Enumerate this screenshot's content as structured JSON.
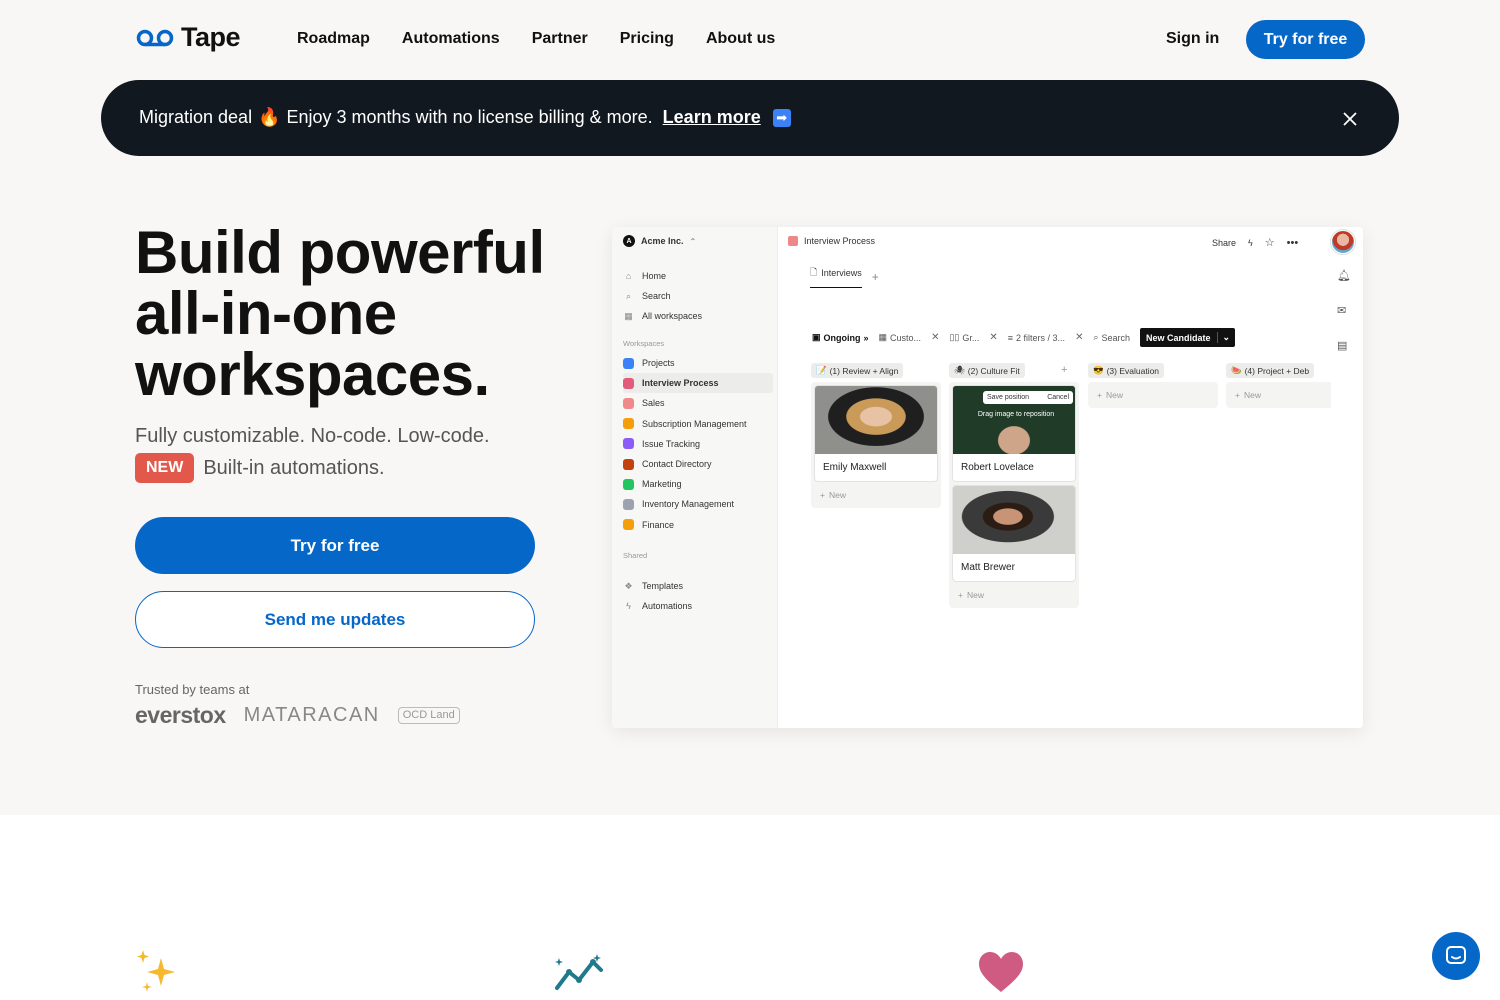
{
  "nav": {
    "logo_text": "Tape",
    "links": [
      "Roadmap",
      "Automations",
      "Partner",
      "Pricing",
      "About us"
    ],
    "signin": "Sign in",
    "cta": "Try for free"
  },
  "banner": {
    "deal": "Migration deal",
    "fire_emoji": "🔥",
    "message": "Enjoy 3 months with no license billing & more.",
    "link": "Learn more",
    "arrow": "➡"
  },
  "hero": {
    "headline_1": "Build powerful",
    "headline_2": "all-in-one",
    "headline_3": "workspaces.",
    "sub1": "Fully customizable. No-code. Low-code.",
    "badge": "NEW",
    "sub2": "Built-in automations.",
    "cta_primary": "Try for free",
    "cta_secondary": "Send me updates",
    "trusted": "Trusted by teams at",
    "logos": [
      "everstox",
      "MATARACAN",
      "OCD Land"
    ]
  },
  "app": {
    "workspace": "Acme Inc.",
    "nav_items": [
      "Home",
      "Search",
      "All workspaces"
    ],
    "workspaces_header": "Workspaces",
    "workspaces": [
      {
        "label": "Projects",
        "color": "#3b82f6"
      },
      {
        "label": "Interview Process",
        "color": "#e25b7a"
      },
      {
        "label": "Sales",
        "color": "#f08a8a"
      },
      {
        "label": "Subscription Management",
        "color": "#f59e0b"
      },
      {
        "label": "Issue Tracking",
        "color": "#8b5cf6"
      },
      {
        "label": "Contact Directory",
        "color": "#c2410c"
      },
      {
        "label": "Marketing",
        "color": "#22c55e"
      },
      {
        "label": "Inventory Management",
        "color": "#9ca3af"
      },
      {
        "label": "Finance",
        "color": "#f59e0b"
      }
    ],
    "shared_header": "Shared",
    "shared_items": [
      "Templates",
      "Automations"
    ],
    "breadcrumb": "Interview Process",
    "share": "Share",
    "tab": "Interviews",
    "toolbar": {
      "view": "Ongoing",
      "fields": "Custo...",
      "group": "Gr...",
      "filters": "2 filters / 3...",
      "search": "Search",
      "new_button": "New Candidate"
    },
    "columns": [
      {
        "emoji": "📝",
        "title": "(1) Review + Align",
        "cards": [
          "Emily Maxwell"
        ],
        "new": "New"
      },
      {
        "emoji": "🕷",
        "title": "(2) Culture Fit",
        "cards": [
          "Robert Lovelace",
          "Matt Brewer"
        ],
        "new": "New"
      },
      {
        "emoji": "😎",
        "title": "(3) Evaluation",
        "cards": [],
        "new": "New"
      },
      {
        "emoji": "🍉",
        "title": "(4) Project + Deb",
        "cards": [],
        "new": "New"
      }
    ],
    "reposition_save": "Save position",
    "reposition_cancel": "Cancel",
    "drag_hint": "Drag image to reposition"
  },
  "colors": {
    "brand_blue": "#0567c8",
    "banner_bg": "#121820",
    "badge_red": "#e2594c",
    "hero_bg": "#f9f7f5"
  }
}
